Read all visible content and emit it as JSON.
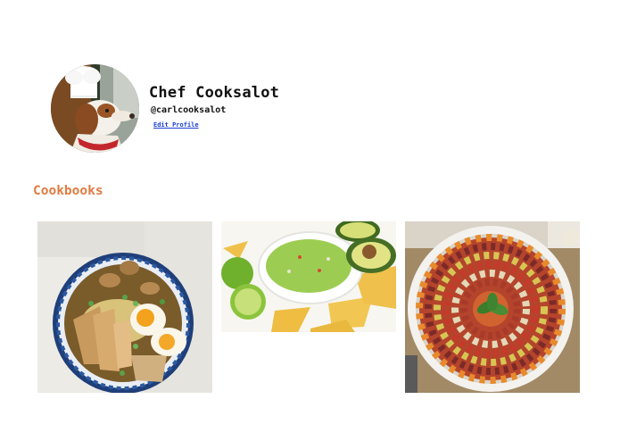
{
  "profile": {
    "name": "Chef Cooksalot",
    "handle": "@carlcooksalot",
    "edit_label": "Edit Profile"
  },
  "cookbooks": {
    "title": "Cookbooks",
    "accent_color": "#e07b41",
    "items": [
      {
        "image": "ramen-bowl-photo"
      },
      {
        "image": "guacamole-chips-photo"
      },
      {
        "image": "ratatouille-dish-photo"
      }
    ]
  },
  "colors": {
    "link": "#1a3fd1"
  }
}
